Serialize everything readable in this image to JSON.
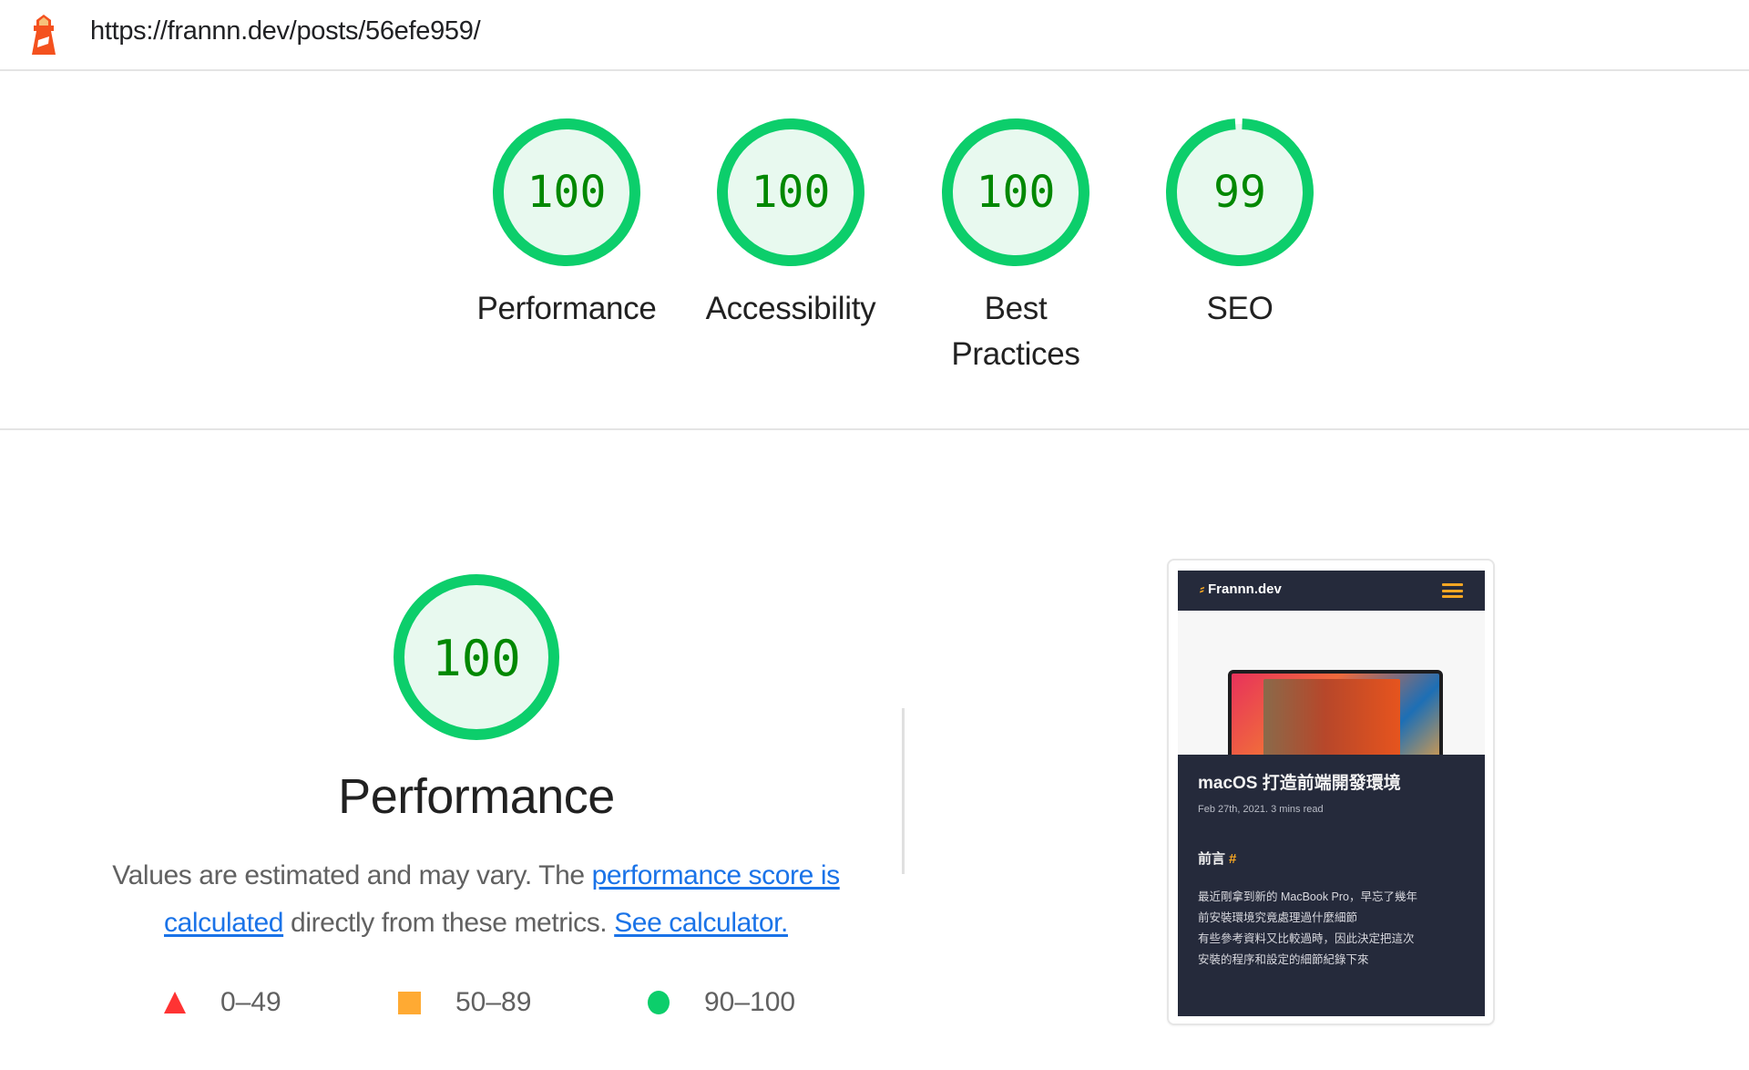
{
  "header": {
    "icon": "lighthouse-icon",
    "url": "https://frannn.dev/posts/56efe959/"
  },
  "colors": {
    "pass": "#0cce6b",
    "pass_text": "#008800",
    "pass_bg": "#e8f9ef",
    "average": "#ffaa33",
    "fail": "#ff3333",
    "link": "#1a73e8"
  },
  "scores": [
    {
      "label": "Performance",
      "value": 100
    },
    {
      "label": "Accessibility",
      "value": 100
    },
    {
      "label": "Best Practices",
      "value": 100
    },
    {
      "label": "SEO",
      "value": 99
    }
  ],
  "performance": {
    "score": 100,
    "title": "Performance",
    "description_prefix": "Values are estimated and may vary. The ",
    "link_score": "performance score is calculated",
    "description_mid": " directly from these metrics. ",
    "link_calculator": "See calculator.",
    "legend": [
      {
        "shape": "triangle-icon",
        "range": "0–49"
      },
      {
        "shape": "square-icon",
        "range": "50–89"
      },
      {
        "shape": "circle-icon",
        "range": "90–100"
      }
    ]
  },
  "screenshot": {
    "site_name": "Frannn.dev",
    "menu_icon": "hamburger-icon",
    "article_title": "macOS 打造前端開發環境",
    "article_meta": "Feb 27th, 2021. 3 mins read",
    "section_heading": "前言",
    "section_anchor": "#",
    "body_lines": [
      "最近剛拿到新的 MacBook Pro，早忘了幾年",
      "前安裝環境究竟處理過什麼細節",
      "有些參考資料又比較過時，因此決定把這次",
      "安裝的程序和設定的細節紀錄下來"
    ]
  }
}
